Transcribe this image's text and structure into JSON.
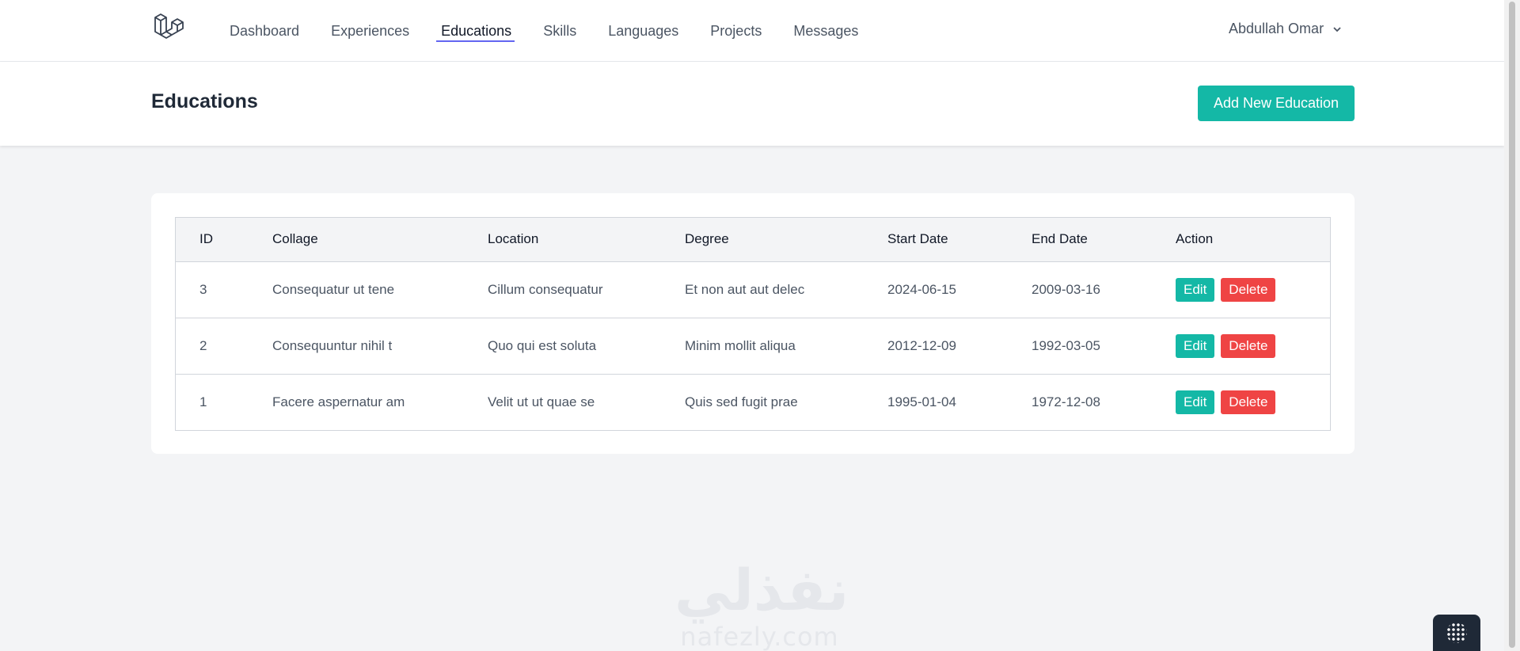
{
  "nav": {
    "links": [
      {
        "label": "Dashboard",
        "active": false
      },
      {
        "label": "Experiences",
        "active": false
      },
      {
        "label": "Educations",
        "active": true
      },
      {
        "label": "Skills",
        "active": false
      },
      {
        "label": "Languages",
        "active": false
      },
      {
        "label": "Projects",
        "active": false
      },
      {
        "label": "Messages",
        "active": false
      }
    ],
    "user_name": "Abdullah Omar"
  },
  "header": {
    "title": "Educations",
    "add_button_label": "Add New Education"
  },
  "table": {
    "columns": [
      "ID",
      "Collage",
      "Location",
      "Degree",
      "Start Date",
      "End Date",
      "Action"
    ],
    "rows": [
      {
        "id": "3",
        "collage": "Consequatur ut tene",
        "location": "Cillum consequatur",
        "degree": "Et non aut aut delec",
        "start_date": "2024-06-15",
        "end_date": "2009-03-16"
      },
      {
        "id": "2",
        "collage": "Consequuntur nihil t",
        "location": "Quo qui est soluta",
        "degree": "Minim mollit aliqua",
        "start_date": "2012-12-09",
        "end_date": "1992-03-05"
      },
      {
        "id": "1",
        "collage": "Facere aspernatur am",
        "location": "Velit ut ut quae se",
        "degree": "Quis sed fugit prae",
        "start_date": "1995-01-04",
        "end_date": "1972-12-08"
      }
    ],
    "edit_label": "Edit",
    "delete_label": "Delete"
  },
  "watermark": {
    "arabic_text": "نفذلي",
    "latin_text": "nafezly.com"
  },
  "colors": {
    "accent_teal": "#14b8a6",
    "danger_red": "#ef4444",
    "active_underline": "#6366f1"
  },
  "icons": {
    "logo": "laravel-logo-icon",
    "user_menu": "chevron-down-icon"
  }
}
